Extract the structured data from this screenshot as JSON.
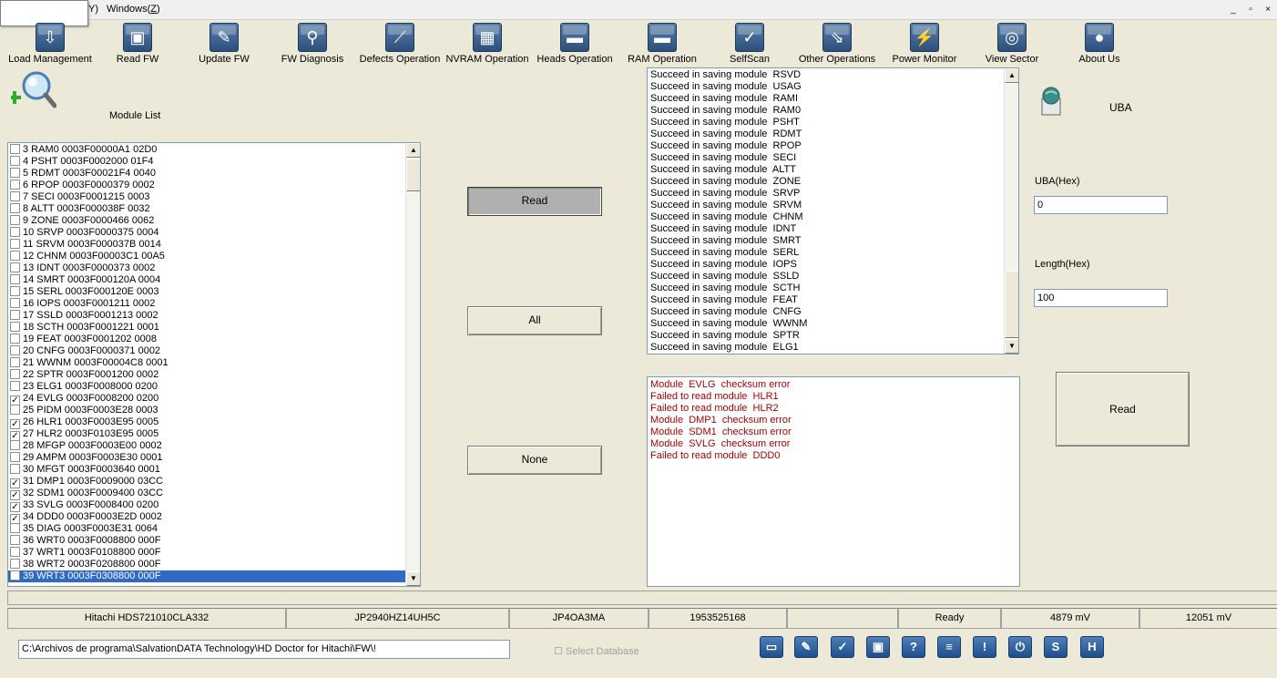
{
  "menubar": {
    "items": [
      {
        "label": "Y)",
        "underline": "Y"
      },
      {
        "label": "Windows(",
        "underline": "Z",
        "suffix": ")"
      }
    ],
    "controls": [
      "_",
      "▫",
      "×"
    ]
  },
  "toolbar": {
    "items": [
      {
        "label": "Load Management",
        "icon": "load-management-icon"
      },
      {
        "label": "Read FW",
        "icon": "read-fw-icon"
      },
      {
        "label": "Update FW",
        "icon": "update-fw-icon"
      },
      {
        "label": "FW Diagnosis",
        "icon": "fw-diagnosis-icon"
      },
      {
        "label": "Defects Operation",
        "icon": "defects-icon"
      },
      {
        "label": "NVRAM Operation",
        "icon": "nvram-icon"
      },
      {
        "label": "Heads Operation",
        "icon": "heads-icon"
      },
      {
        "label": "RAM Operation",
        "icon": "ram-icon"
      },
      {
        "label": "SelfScan",
        "icon": "selfscan-icon"
      },
      {
        "label": "Other Operations",
        "icon": "other-operations-icon"
      },
      {
        "label": "Power Monitor",
        "icon": "power-monitor-icon"
      },
      {
        "label": "View Sector",
        "icon": "view-sector-icon"
      },
      {
        "label": "About Us",
        "icon": "about-us-icon"
      }
    ]
  },
  "module_panel": {
    "title": "Module List",
    "rows": [
      {
        "text": "3 RAM0 0003F00000A1  02D0",
        "checked": false
      },
      {
        "text": "4 PSHT 0003F0002000  01F4",
        "checked": false
      },
      {
        "text": "5 RDMT 0003F00021F4  0040",
        "checked": false
      },
      {
        "text": "6 RPOP 0003F0000379  0002",
        "checked": false
      },
      {
        "text": "7 SECI 0003F0001215  0003",
        "checked": false
      },
      {
        "text": "8 ALTT 0003F000038F  0032",
        "checked": false
      },
      {
        "text": "9 ZONE 0003F0000466  0062",
        "checked": false
      },
      {
        "text": "10 SRVP 0003F0000375  0004",
        "checked": false
      },
      {
        "text": "11 SRVM 0003F000037B  0014",
        "checked": false
      },
      {
        "text": "12 CHNM 0003F00003C1  00A5",
        "checked": false
      },
      {
        "text": "13 IDNT 0003F0000373  0002",
        "checked": false
      },
      {
        "text": "14 SMRT 0003F000120A  0004",
        "checked": false
      },
      {
        "text": "15 SERL 0003F000120E  0003",
        "checked": false
      },
      {
        "text": "16 IOPS 0003F0001211  0002",
        "checked": false
      },
      {
        "text": "17 SSLD 0003F0001213  0002",
        "checked": false
      },
      {
        "text": "18 SCTH 0003F0001221  0001",
        "checked": false
      },
      {
        "text": "19 FEAT 0003F0001202  0008",
        "checked": false
      },
      {
        "text": "20 CNFG 0003F0000371  0002",
        "checked": false
      },
      {
        "text": "21 WWNM 0003F00004C8  0001",
        "checked": false
      },
      {
        "text": "22 SPTR 0003F0001200  0002",
        "checked": false
      },
      {
        "text": "23 ELG1 0003F0008000  0200",
        "checked": false
      },
      {
        "text": "24 EVLG 0003F0008200  0200",
        "checked": true
      },
      {
        "text": "25 PIDM 0003F0003E28  0003",
        "checked": false
      },
      {
        "text": "26 HLR1 0003F0003E95  0005",
        "checked": true
      },
      {
        "text": "27 HLR2 0003F0103E95  0005",
        "checked": true
      },
      {
        "text": "28 MFGP 0003F0003E00  0002",
        "checked": false
      },
      {
        "text": "29 AMPM 0003F0003E30  0001",
        "checked": false
      },
      {
        "text": "30 MFGT 0003F0003640  0001",
        "checked": false
      },
      {
        "text": "31 DMP1 0003F0009000  03CC",
        "checked": true
      },
      {
        "text": "32 SDM1 0003F0009400  03CC",
        "checked": true
      },
      {
        "text": "33 SVLG 0003F0008400  0200",
        "checked": true
      },
      {
        "text": "34 DDD0 0003F0003E2D  0002",
        "checked": true
      },
      {
        "text": "35 DIAG 0003F0003E31  0064",
        "checked": false
      },
      {
        "text": "36 WRT0 0003F0008800  000F",
        "checked": false
      },
      {
        "text": "37 WRT1 0003F0108800  000F",
        "checked": false
      },
      {
        "text": "38 WRT2 0003F0208800  000F",
        "checked": false
      },
      {
        "text": "39 WRT3 0003F0308800  000F",
        "checked": false,
        "selected": true
      }
    ]
  },
  "buttons": {
    "read": "Read",
    "all": "All",
    "none": "None",
    "uba_read": "Read"
  },
  "log": {
    "lines": [
      "Succeed in saving module  RSVD",
      "Succeed in saving module  USAG",
      "Succeed in saving module  RAMI",
      "Succeed in saving module  RAM0",
      "Succeed in saving module  PSHT",
      "Succeed in saving module  RDMT",
      "Succeed in saving module  RPOP",
      "Succeed in saving module  SECI",
      "Succeed in saving module  ALTT",
      "Succeed in saving module  ZONE",
      "Succeed in saving module  SRVP",
      "Succeed in saving module  SRVM",
      "Succeed in saving module  CHNM",
      "Succeed in saving module  IDNT",
      "Succeed in saving module  SMRT",
      "Succeed in saving module  SERL",
      "Succeed in saving module  IOPS",
      "Succeed in saving module  SSLD",
      "Succeed in saving module  SCTH",
      "Succeed in saving module  FEAT",
      "Succeed in saving module  CNFG",
      "Succeed in saving module  WWNM",
      "Succeed in saving module  SPTR",
      "Succeed in saving module  ELG1"
    ]
  },
  "errors": {
    "lines": [
      "Module  EVLG  checksum error",
      "Failed to read module  HLR1",
      "Failed to read module  HLR2",
      "Module  DMP1  checksum error",
      "Module  SDM1  checksum error",
      "Module  SVLG  checksum error",
      "Failed to read module  DDD0"
    ]
  },
  "uba_panel": {
    "title": "UBA",
    "uba_label": "UBA(Hex)",
    "uba_value": "0",
    "length_label": "Length(Hex)",
    "length_value": "100"
  },
  "status": {
    "model": "Hitachi HDS721010CLA332",
    "serial": "JP2940HZ14UH5C",
    "firmware": "JP4OA3MA",
    "capacity": "1953525168",
    "blank": "",
    "state": "Ready",
    "voltage5": "4879 mV",
    "voltage12": "12051 mV"
  },
  "bottom": {
    "path": "C:\\Archivos de programa\\SalvationDATA Technology\\HD Doctor for Hitachi\\FW\\!",
    "select_db": "Select Database",
    "icons": [
      "open-folder-icon",
      "edit-doc-icon",
      "check-icon",
      "save-disk-icon",
      "help-icon",
      "notes-icon",
      "info-icon",
      "power-icon",
      "s-icon",
      "h-icon"
    ],
    "icon_glyphs": [
      "▭",
      "✎",
      "✓",
      "▣",
      "?",
      "≡",
      "!",
      "⏻",
      "S",
      "H"
    ]
  }
}
